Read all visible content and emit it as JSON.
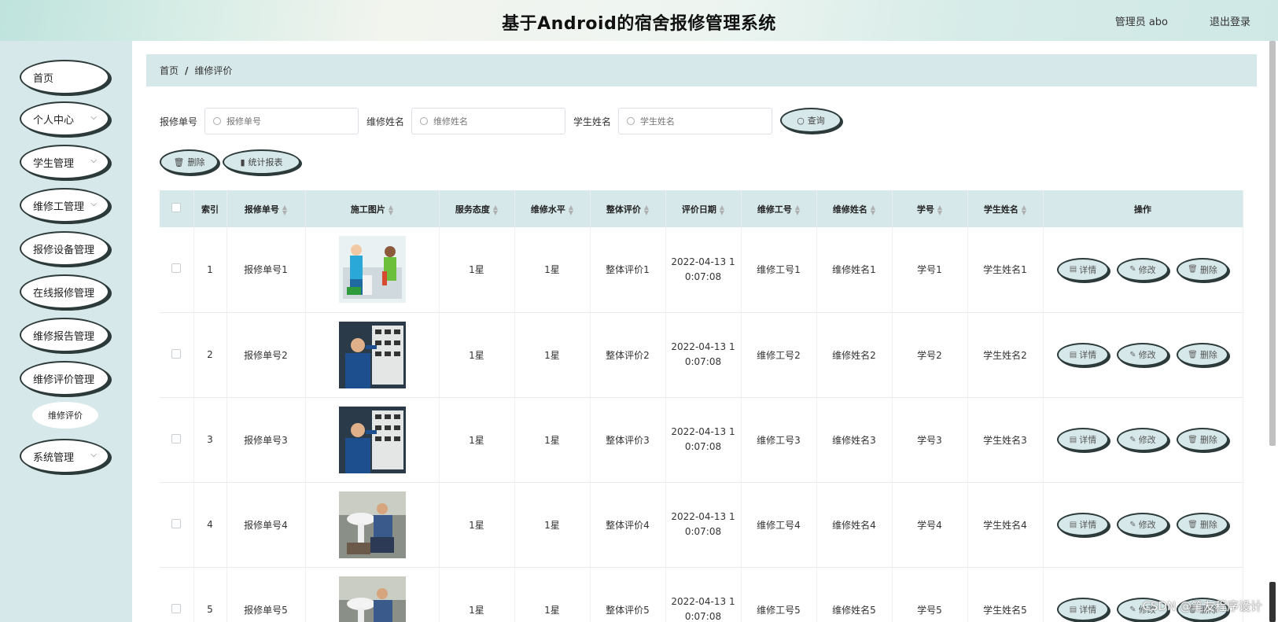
{
  "header": {
    "title": "基于Android的宿舍报修管理系统",
    "user": "管理员 abo",
    "logout": "退出登录"
  },
  "sidebar": {
    "items": [
      {
        "label": "首页",
        "has_arrow": false
      },
      {
        "label": "个人中心",
        "has_arrow": true
      },
      {
        "label": "学生管理",
        "has_arrow": true
      },
      {
        "label": "维修工管理",
        "has_arrow": true
      },
      {
        "label": "报修设备管理",
        "has_arrow": false
      },
      {
        "label": "在线报修管理",
        "has_arrow": false
      },
      {
        "label": "维修报告管理",
        "has_arrow": false
      },
      {
        "label": "维修评价管理",
        "has_arrow": false
      },
      {
        "label": "系统管理",
        "has_arrow": true
      }
    ],
    "sub_item": "维修评价"
  },
  "breadcrumb": {
    "home": "首页",
    "separator": "/",
    "current": "维修评价"
  },
  "search": {
    "fields": [
      {
        "label": "报修单号",
        "placeholder": "报修单号"
      },
      {
        "label": "维修姓名",
        "placeholder": "维修姓名"
      },
      {
        "label": "学生姓名",
        "placeholder": "学生姓名"
      }
    ],
    "query_button": "查询"
  },
  "actions": {
    "delete": "删除",
    "report": "统计报表"
  },
  "table": {
    "headers": [
      "索引",
      "报修单号",
      "施工图片",
      "服务态度",
      "维修水平",
      "整体评价",
      "评价日期",
      "维修工号",
      "维修姓名",
      "学号",
      "学生姓名",
      "操作"
    ],
    "rows": [
      {
        "index": "1",
        "order": "报修单号1",
        "image": "repair-plumbing-photo",
        "service": "1星",
        "level": "1星",
        "overall": "整体评价1",
        "date": "2022-04-13 1\n0:07:08",
        "worker_id": "维修工号1",
        "worker_name": "维修姓名1",
        "student_id": "学号1",
        "student_name": "学生姓名1"
      },
      {
        "index": "2",
        "order": "报修单号2",
        "image": "electrical-panel-photo",
        "service": "1星",
        "level": "1星",
        "overall": "整体评价2",
        "date": "2022-04-13 1\n0:07:08",
        "worker_id": "维修工号2",
        "worker_name": "维修姓名2",
        "student_id": "学号2",
        "student_name": "学生姓名2"
      },
      {
        "index": "3",
        "order": "报修单号3",
        "image": "electrical-panel-photo",
        "service": "1星",
        "level": "1星",
        "overall": "整体评价3",
        "date": "2022-04-13 1\n0:07:08",
        "worker_id": "维修工号3",
        "worker_name": "维修姓名3",
        "student_id": "学号3",
        "student_name": "学生姓名3"
      },
      {
        "index": "4",
        "order": "报修单号4",
        "image": "sink-repair-photo",
        "service": "1星",
        "level": "1星",
        "overall": "整体评价4",
        "date": "2022-04-13 1\n0:07:08",
        "worker_id": "维修工号4",
        "worker_name": "维修姓名4",
        "student_id": "学号4",
        "student_name": "学生姓名4"
      },
      {
        "index": "5",
        "order": "报修单号5",
        "image": "sink-repair-photo",
        "service": "1星",
        "level": "1星",
        "overall": "整体评价5",
        "date": "2022-04-13 1\n0:07:08",
        "worker_id": "维修工号5",
        "worker_name": "维修姓名5",
        "student_id": "学号5",
        "student_name": "学生姓名5"
      }
    ],
    "row_actions": {
      "detail": "详情",
      "edit": "修改",
      "delete": "删除"
    }
  },
  "watermark": "CSDN @笔友程序设计",
  "colors": {
    "accent": "#d7e8ea",
    "border": "#2d3a3a"
  }
}
